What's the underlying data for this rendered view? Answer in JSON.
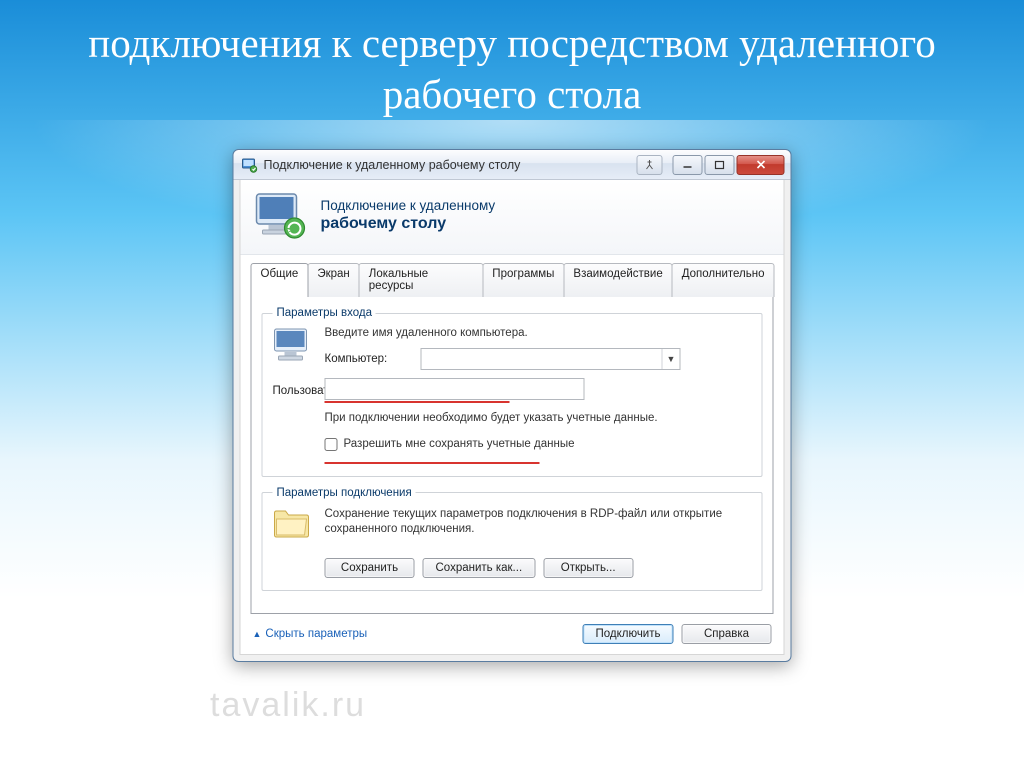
{
  "slide": {
    "title": "подключения к серверу посредством удаленного рабочего стола"
  },
  "window": {
    "title": "Подключение к удаленному рабочему столу",
    "header_line1": "Подключение к удаленному",
    "header_line2": "рабочему столу"
  },
  "tabs": {
    "general": "Общие",
    "display": "Экран",
    "local": "Локальные ресурсы",
    "programs": "Программы",
    "experience": "Взаимодействие",
    "advanced": "Дополнительно"
  },
  "login_group": {
    "legend": "Параметры входа",
    "hint": "Введите имя удаленного компьютера.",
    "computer_label": "Компьютер:",
    "computer_value": "",
    "user_label": "Пользователь:",
    "user_value": "",
    "note": "При подключении необходимо будет указать учетные данные.",
    "allow_save_label": "Разрешить мне сохранять учетные данные"
  },
  "conn_group": {
    "legend": "Параметры подключения",
    "text": "Сохранение текущих параметров подключения в RDP-файл или открытие сохраненного подключения.",
    "save": "Сохранить",
    "save_as": "Сохранить как...",
    "open": "Открыть..."
  },
  "bottom": {
    "hide_options": "Скрыть параметры",
    "connect": "Подключить",
    "help": "Справка"
  },
  "watermark": "tavalik.ru"
}
